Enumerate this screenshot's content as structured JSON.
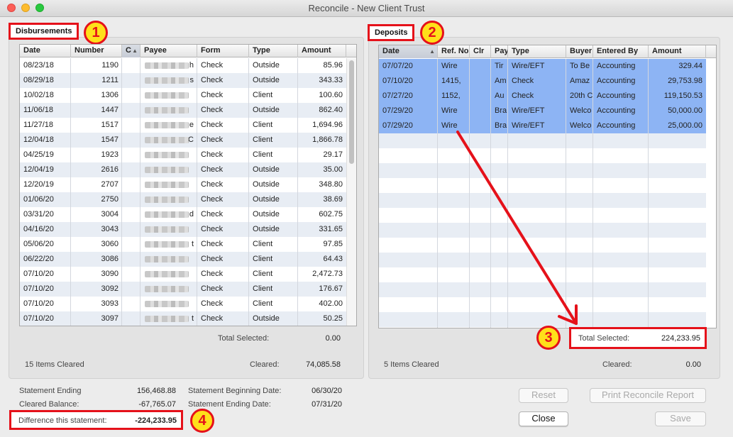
{
  "window": {
    "title": "Reconcile - New Client Trust"
  },
  "colors": {
    "annotation_red": "#e5111a",
    "callout_yellow": "#ffe01a",
    "selection_blue": "#8db4f4"
  },
  "callouts": [
    "1",
    "2",
    "3",
    "4"
  ],
  "disbursements": {
    "tab_label": "Disbursements",
    "columns": [
      "Date",
      "Number",
      "C",
      "Payee",
      "Form",
      "Type",
      "Amount"
    ],
    "sorted_column": "C",
    "rows": [
      {
        "date": "08/23/18",
        "number": "1190",
        "payee": "",
        "payee_tail": "h",
        "form": "Check",
        "type": "Outside",
        "amount": "85.96"
      },
      {
        "date": "08/29/18",
        "number": "1211",
        "payee": "",
        "payee_tail": "s",
        "form": "Check",
        "type": "Outside",
        "amount": "343.33"
      },
      {
        "date": "10/02/18",
        "number": "1306",
        "payee": "",
        "payee_tail": "",
        "form": "Check",
        "type": "Client",
        "amount": "100.60"
      },
      {
        "date": "11/06/18",
        "number": "1447",
        "payee": "",
        "payee_tail": "",
        "form": "Check",
        "type": "Outside",
        "amount": "862.40"
      },
      {
        "date": "11/27/18",
        "number": "1517",
        "payee": "",
        "payee_tail": "e",
        "form": "Check",
        "type": "Client",
        "amount": "1,694.96"
      },
      {
        "date": "12/04/18",
        "number": "1547",
        "payee": "",
        "payee_tail": "C",
        "form": "Check",
        "type": "Client",
        "amount": "1,866.78"
      },
      {
        "date": "04/25/19",
        "number": "1923",
        "payee": "",
        "payee_tail": "",
        "form": "Check",
        "type": "Client",
        "amount": "29.17"
      },
      {
        "date": "12/04/19",
        "number": "2616",
        "payee": "",
        "payee_tail": "",
        "form": "Check",
        "type": "Outside",
        "amount": "35.00"
      },
      {
        "date": "12/20/19",
        "number": "2707",
        "payee": "",
        "payee_tail": "",
        "form": "Check",
        "type": "Outside",
        "amount": "348.80"
      },
      {
        "date": "01/06/20",
        "number": "2750",
        "payee": "",
        "payee_tail": "",
        "form": "Check",
        "type": "Outside",
        "amount": "38.69"
      },
      {
        "date": "03/31/20",
        "number": "3004",
        "payee": "",
        "payee_tail": "d",
        "form": "Check",
        "type": "Outside",
        "amount": "602.75"
      },
      {
        "date": "04/16/20",
        "number": "3043",
        "payee": "",
        "payee_tail": "",
        "form": "Check",
        "type": "Outside",
        "amount": "331.65"
      },
      {
        "date": "05/06/20",
        "number": "3060",
        "payee": "",
        "payee_tail": "t",
        "form": "Check",
        "type": "Client",
        "amount": "97.85"
      },
      {
        "date": "06/22/20",
        "number": "3086",
        "payee": "",
        "payee_tail": "",
        "form": "Check",
        "type": "Client",
        "amount": "64.43"
      },
      {
        "date": "07/10/20",
        "number": "3090",
        "payee": "",
        "payee_tail": "",
        "form": "Check",
        "type": "Client",
        "amount": "2,472.73"
      },
      {
        "date": "07/10/20",
        "number": "3092",
        "payee": "",
        "payee_tail": "",
        "form": "Check",
        "type": "Client",
        "amount": "176.67"
      },
      {
        "date": "07/10/20",
        "number": "3093",
        "payee": "",
        "payee_tail": "",
        "form": "Check",
        "type": "Client",
        "amount": "402.00"
      },
      {
        "date": "07/10/20",
        "number": "3097",
        "payee": "",
        "payee_tail": "t",
        "form": "Check",
        "type": "Outside",
        "amount": "50.25"
      }
    ],
    "total_selected_label": "Total Selected:",
    "total_selected_value": "0.00",
    "items_cleared": "15 Items Cleared",
    "cleared_label": "Cleared:",
    "cleared_value": "74,085.58"
  },
  "deposits": {
    "tab_label": "Deposits",
    "columns": [
      "Date",
      "Ref. No",
      "Clr",
      "Pay",
      "Type",
      "Buyer",
      "Entered By",
      "Amount"
    ],
    "sorted_column": "Date",
    "rows": [
      {
        "date": "07/07/20",
        "ref": "Wire",
        "clr": "",
        "pay": "Tir",
        "type": "Wire/EFT",
        "buyer": "To Be",
        "entered_by": "Accounting",
        "amount": "329.44"
      },
      {
        "date": "07/10/20",
        "ref": "1415,",
        "clr": "",
        "pay": "Am",
        "type": "Check",
        "buyer": "Amaz",
        "entered_by": "Accounting",
        "amount": "29,753.98"
      },
      {
        "date": "07/27/20",
        "ref": "1152,",
        "clr": "",
        "pay": "Au",
        "type": "Check",
        "buyer": "20th C",
        "entered_by": "Accounting",
        "amount": "119,150.53"
      },
      {
        "date": "07/29/20",
        "ref": "Wire",
        "clr": "",
        "pay": "Bra",
        "type": "Wire/EFT",
        "buyer": "Welco",
        "entered_by": "Accounting",
        "amount": "50,000.00"
      },
      {
        "date": "07/29/20",
        "ref": "Wire",
        "clr": "",
        "pay": "Bra",
        "type": "Wire/EFT",
        "buyer": "Welco",
        "entered_by": "Accounting",
        "amount": "25,000.00"
      }
    ],
    "total_selected_label": "Total Selected:",
    "total_selected_value": "224,233.95",
    "items_cleared": "5 Items Cleared",
    "cleared_label": "Cleared:",
    "cleared_value": "0.00"
  },
  "summary": {
    "statement_ending_label": "Statement Ending",
    "statement_ending_value": "156,468.88",
    "cleared_balance_label": "Cleared Balance:",
    "cleared_balance_value": "-67,765.07",
    "difference_label": "Difference this statement:",
    "difference_value": "-224,233.95",
    "beginning_date_label": "Statement Beginning Date:",
    "beginning_date_value": "06/30/20",
    "ending_date_label": "Statement Ending Date:",
    "ending_date_value": "07/31/20"
  },
  "buttons": {
    "reset": "Reset",
    "print_report": "Print Reconcile Report",
    "close": "Close",
    "save": "Save"
  }
}
